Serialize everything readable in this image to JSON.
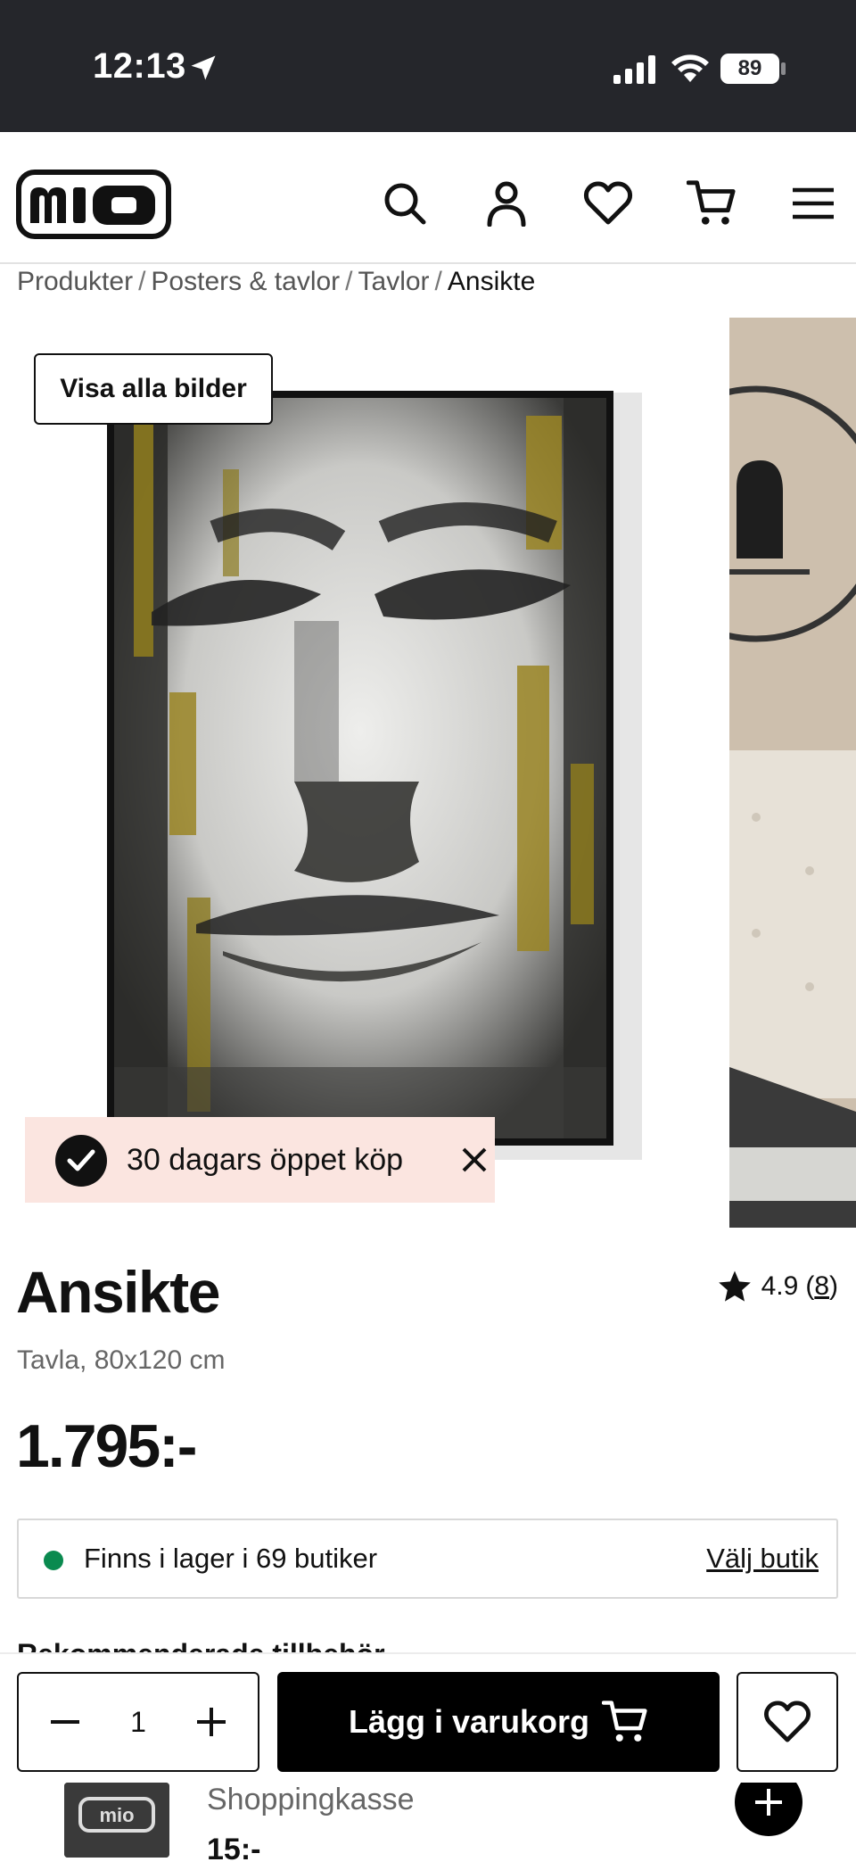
{
  "status_bar": {
    "time": "12:13",
    "battery": "89"
  },
  "header": {
    "logo_text": "mio",
    "icons": [
      "search-icon",
      "user-icon",
      "heart-icon",
      "cart-icon",
      "menu-icon"
    ]
  },
  "breadcrumb": {
    "items": [
      "Produkter",
      "Posters & tavlor",
      "Tavlor"
    ],
    "separator": "/",
    "current": "Ansikte"
  },
  "gallery": {
    "view_all_label": "Visa alla bilder",
    "promo_text": "30 dagars öppet köp"
  },
  "product": {
    "title": "Ansikte",
    "subtitle": "Tavla, 80x120 cm",
    "price": "1.795:-",
    "rating_value": "4.9",
    "rating_count": "8",
    "stock_text": "Finns i lager i 69 butiker",
    "choose_store_label": "Välj butik",
    "stock_color": "#0a8a4f"
  },
  "accessories": {
    "title": "Rekommenderade tillbehör",
    "item_name": "Shoppingkasse",
    "item_price": "15:-"
  },
  "sticky_bar": {
    "quantity": "1",
    "add_to_cart_label": "Lägg i varukorg"
  },
  "colors": {
    "status_bg": "#25262b",
    "promo_bg": "#fbe5e0",
    "primary": "#000000"
  }
}
